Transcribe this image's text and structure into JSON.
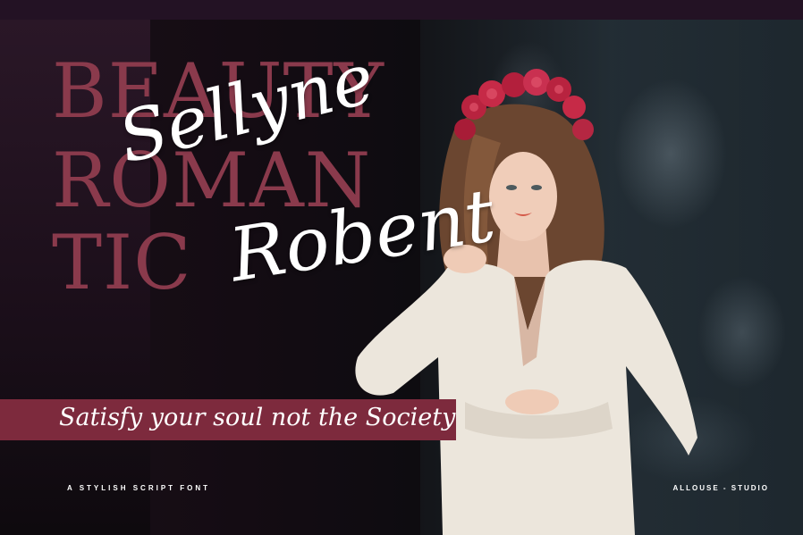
{
  "background_words": [
    "BEAUTY",
    "ROMAN",
    "TIC"
  ],
  "script_title": {
    "line1": "Sellyne",
    "line2": "Robent"
  },
  "tagline": "Satisfy your soul not the Society",
  "footer": {
    "left": "A STYLISH SCRIPT FONT",
    "right": "ALLOUSE - STUDIO"
  },
  "colors": {
    "accent": "#7d2a3d",
    "bg_text": "#8a3a4c",
    "title": "#ffffff"
  }
}
